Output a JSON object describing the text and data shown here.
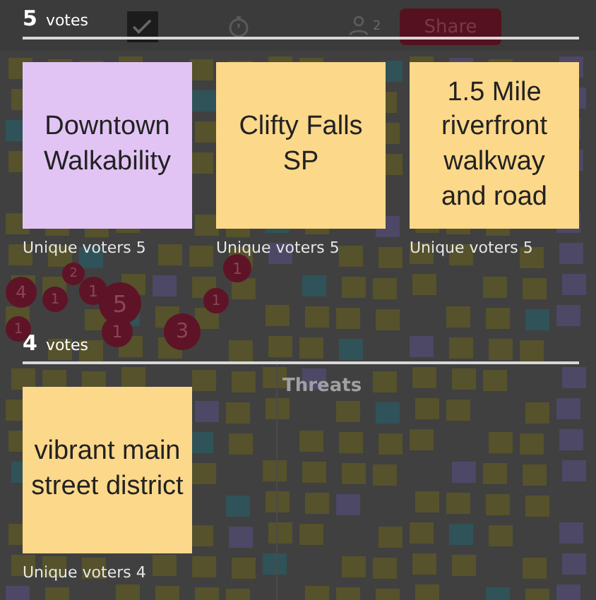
{
  "toolbar": {
    "collaborators": "2",
    "share": "Share"
  },
  "board": {
    "frame_title": "Threats",
    "vote_badges": [
      "4",
      "1",
      "1",
      "5",
      "2",
      "1",
      "1",
      "3",
      "1",
      "1"
    ]
  },
  "results": [
    {
      "votes": "5",
      "votes_label": "votes",
      "cards": [
        {
          "text": "Downtown Walkability",
          "color": "#e2c4f4",
          "voters_label": "Unique voters 5"
        },
        {
          "text": "Clifty Falls SP",
          "color": "#fcd88a",
          "voters_label": "Unique voters 5"
        },
        {
          "text": "1.5 Mile riverfront walkway and road",
          "color": "#fcd88a",
          "voters_label": "Unique voters 5"
        }
      ]
    },
    {
      "votes": "4",
      "votes_label": "votes",
      "cards": [
        {
          "text": "vibrant main street district",
          "color": "#fcd88a",
          "voters_label": "Unique voters 4"
        }
      ]
    }
  ]
}
